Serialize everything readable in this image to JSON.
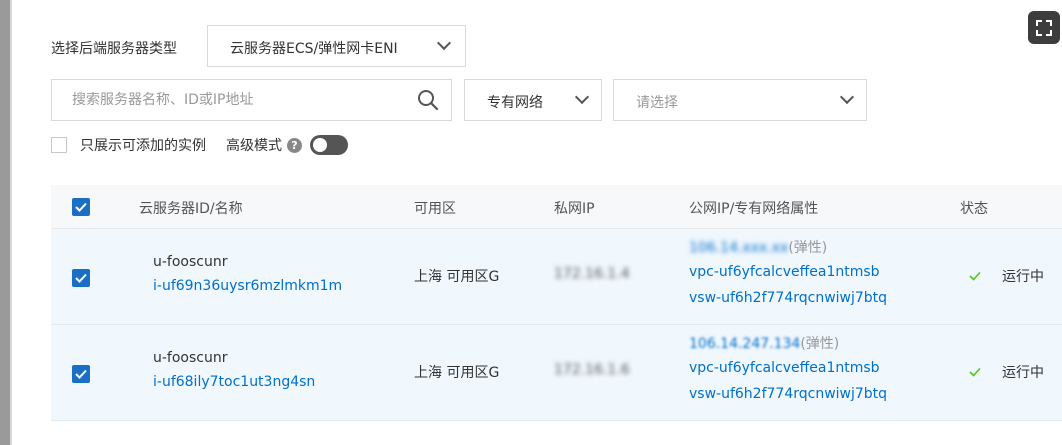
{
  "filter": {
    "server_type_label": "选择后端服务器类型",
    "server_type_value": "云服务器ECS/弹性网卡ENI",
    "search_placeholder": "搜索服务器名称、ID或IP地址",
    "network_type_value": "专有网络",
    "vpc_placeholder": "请选择",
    "only_addable_label": "只展示可添加的实例",
    "advanced_mode_label": "高级模式",
    "advanced_mode_enabled": false
  },
  "table": {
    "headers": [
      "云服务器ID/名称",
      "可用区",
      "私网IP",
      "公网IP/专有网络属性",
      "状态"
    ],
    "select_all_checked": true,
    "rows": [
      {
        "checked": true,
        "name": "u-fooscunr",
        "id": "i-uf69n36uysr6mzlmkm1m",
        "zone": "上海 可用区G",
        "private_ip": "172.16.1.4",
        "public_ip": "106.14.xxx.xx",
        "public_ip_suffix": "(弹性)",
        "vpc": "vpc-uf6yfcalcveffea1ntmsb",
        "vsw": "vsw-uf6h2f774rqcnwiwj7btq",
        "status": "运行中",
        "status_icon": "check-icon"
      },
      {
        "checked": true,
        "name": "u-fooscunr",
        "id": "i-uf68ily7toc1ut3ng4sn",
        "zone": "上海 可用区G",
        "private_ip": "172.16.1.6",
        "public_ip": "106.14.247.134",
        "public_ip_suffix": "(弹性)",
        "vpc": "vpc-uf6yfcalcveffea1ntmsb",
        "vsw": "vsw-uf6h2f774rqcnwiwj7btq",
        "status": "运行中",
        "status_icon": "check-icon"
      }
    ]
  },
  "colors": {
    "accent": "#1a6fc4",
    "link": "#0070cc",
    "row_selected_bg": "#f0f7fd",
    "status_ok": "#52c41a"
  }
}
